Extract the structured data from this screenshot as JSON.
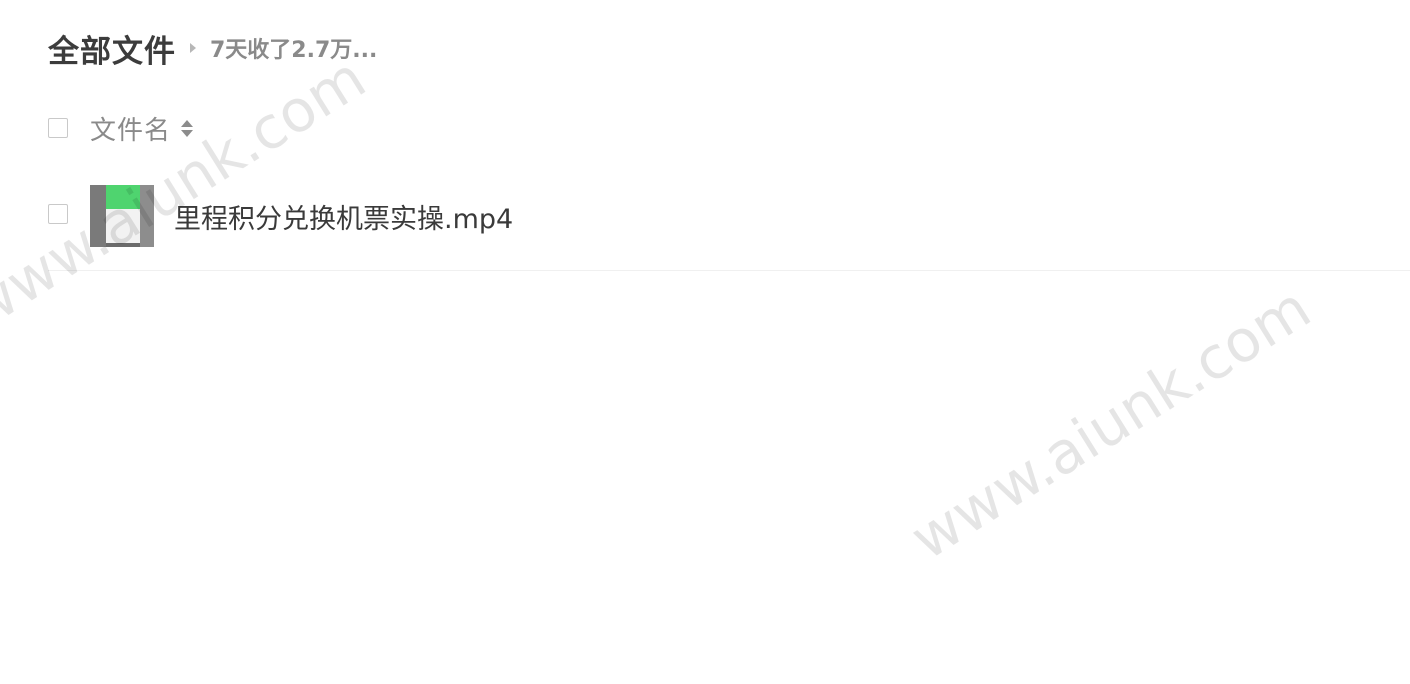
{
  "breadcrumb": {
    "root": "全部文件",
    "current": "7天收了2.7万..."
  },
  "list_header": {
    "name_column": "文件名"
  },
  "files": [
    {
      "name": "里程积分兑换机票实操.mp4",
      "type_icon": "video-thumbnail"
    }
  ],
  "watermark": "www.aiunk.com"
}
